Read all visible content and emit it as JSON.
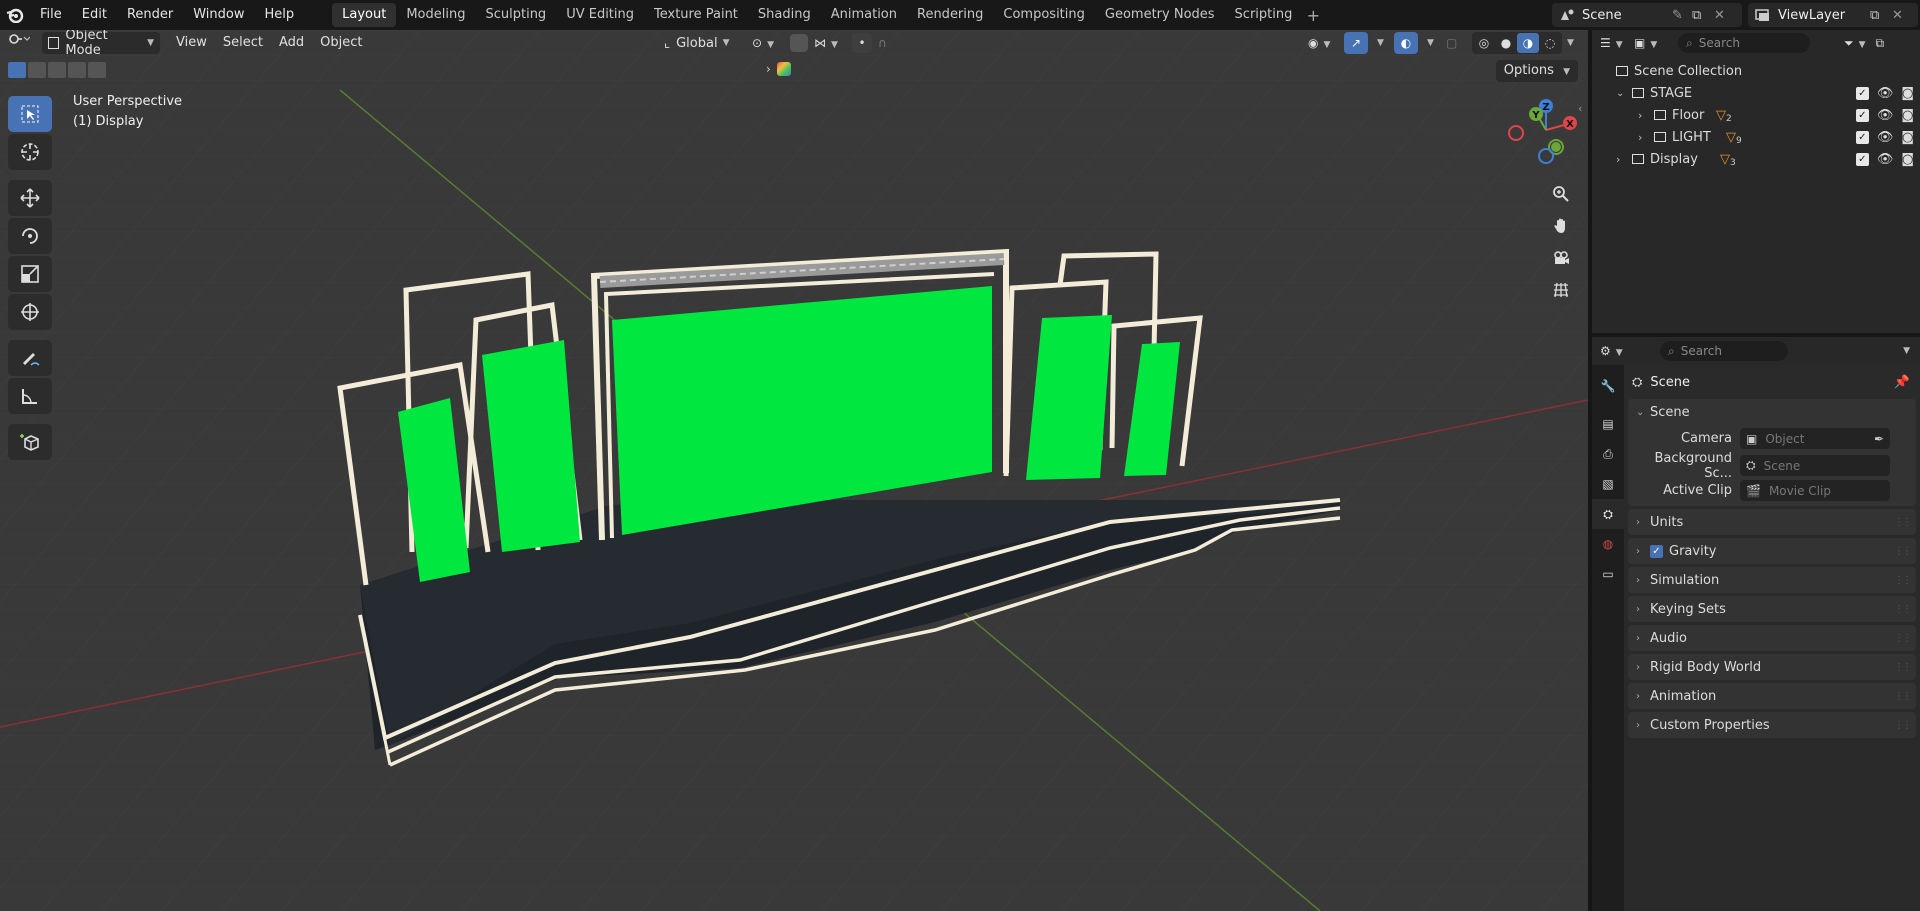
{
  "menu": [
    "File",
    "Edit",
    "Render",
    "Window",
    "Help"
  ],
  "workspaces": [
    "Layout",
    "Modeling",
    "Sculpting",
    "UV Editing",
    "Texture Paint",
    "Shading",
    "Animation",
    "Rendering",
    "Compositing",
    "Geometry Nodes",
    "Scripting"
  ],
  "scene_name": "Scene",
  "view_layer": "ViewLayer",
  "viewport": {
    "mode": "Object Mode",
    "menus": [
      "View",
      "Select",
      "Add",
      "Object"
    ],
    "orientation": "Global",
    "options_label": "Options",
    "overlay_title": "User Perspective",
    "overlay_sub": "(1) Display",
    "gizmo_x": "X",
    "gizmo_y": "Y",
    "gizmo_z": "Z"
  },
  "outliner": {
    "search_placeholder": "Search",
    "root": "Scene Collection",
    "items": [
      {
        "label": "STAGE",
        "count": ""
      },
      {
        "label": "Floor",
        "count": "2"
      },
      {
        "label": "LIGHT",
        "count": "9"
      },
      {
        "label": "Display",
        "count": "3"
      }
    ]
  },
  "properties": {
    "search_placeholder": "Search",
    "context": "Scene",
    "panel_title": "Scene",
    "fields": [
      {
        "label": "Camera",
        "placeholder": "Object"
      },
      {
        "label": "Background Sc...",
        "placeholder": "Scene"
      },
      {
        "label": "Active Clip",
        "placeholder": "Movie Clip"
      }
    ],
    "panels": [
      "Units",
      "Gravity",
      "Simulation",
      "Keying Sets",
      "Audio",
      "Rigid Body World",
      "Animation",
      "Custom Properties"
    ]
  },
  "colors": {
    "accent": "#4772b3",
    "screen_green": "#00e83f",
    "frame": "#f3ecd8",
    "stage_floor": "#262b32",
    "x_axis": "#e0454a",
    "y_axis": "#6aa63a",
    "z_axis": "#3d7fd9"
  }
}
